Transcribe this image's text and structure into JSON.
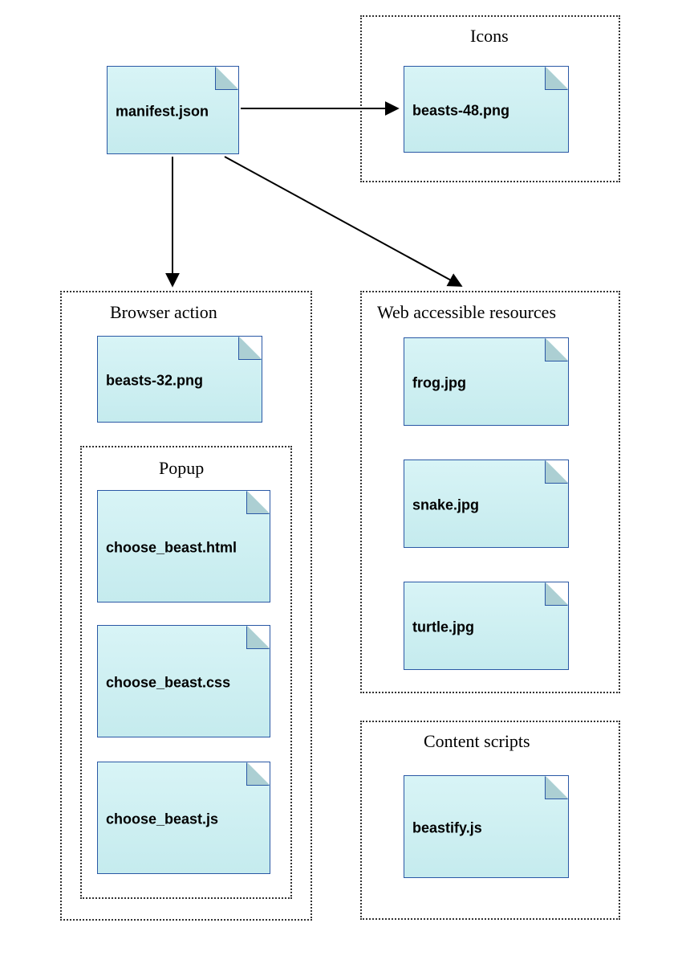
{
  "files": {
    "manifest": "manifest.json",
    "icons_file": "beasts-48.png",
    "browser_action_file": "beasts-32.png",
    "popup_html": "choose_beast.html",
    "popup_css": "choose_beast.css",
    "popup_js": "choose_beast.js",
    "war_frog": "frog.jpg",
    "war_snake": "snake.jpg",
    "war_turtle": "turtle.jpg",
    "content_script": "beastify.js"
  },
  "groups": {
    "icons": "Icons",
    "browser_action": "Browser action",
    "popup": "Popup",
    "war": "Web accessible resources",
    "content_scripts": "Content scripts"
  },
  "chart_data": {
    "type": "diagram",
    "root": "manifest.json",
    "edges": [
      {
        "from": "manifest.json",
        "to": "Icons"
      },
      {
        "from": "manifest.json",
        "to": "Browser action"
      },
      {
        "from": "manifest.json",
        "to": "Web accessible resources"
      }
    ],
    "groups": {
      "Icons": [
        "beasts-48.png"
      ],
      "Browser action": [
        "beasts-32.png",
        {
          "Popup": [
            "choose_beast.html",
            "choose_beast.css",
            "choose_beast.js"
          ]
        }
      ],
      "Web accessible resources": [
        "frog.jpg",
        "snake.jpg",
        "turtle.jpg"
      ],
      "Content scripts": [
        "beastify.js"
      ]
    }
  }
}
